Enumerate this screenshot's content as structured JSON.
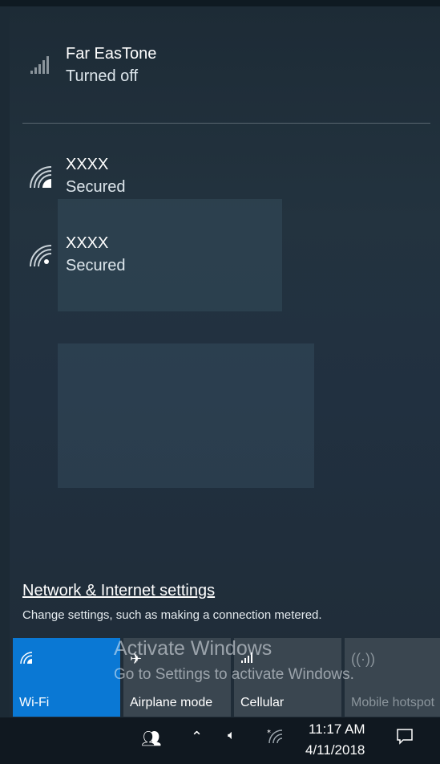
{
  "networks": [
    {
      "name": "Far EasTone",
      "status": "Turned off",
      "icon": "cellular-signal-icon"
    },
    {
      "name": "XXXX",
      "status": "Secured",
      "icon": "wifi-icon"
    },
    {
      "name": "XXXX",
      "status": "Secured",
      "icon": "wifi-icon"
    }
  ],
  "settings": {
    "link": "Network & Internet settings",
    "description": "Change settings, such as making a connection metered."
  },
  "tiles": [
    {
      "label": "Wi-Fi",
      "icon": "wifi-icon",
      "active": true
    },
    {
      "label": "Airplane mode",
      "icon": "airplane-icon",
      "active": false
    },
    {
      "label": "Cellular",
      "icon": "cellular-signal-icon",
      "active": false
    },
    {
      "label": "Mobile hotspot",
      "icon": "hotspot-icon",
      "active": false
    }
  ],
  "watermark": {
    "title": "Activate Windows",
    "subtitle": "Go to Settings to activate Windows."
  },
  "taskbar": {
    "time": "11:17 AM",
    "date": "4/11/2018"
  },
  "colors": {
    "accent": "#0a78d4",
    "tile": "#3a4650",
    "taskbar": "#101820"
  }
}
